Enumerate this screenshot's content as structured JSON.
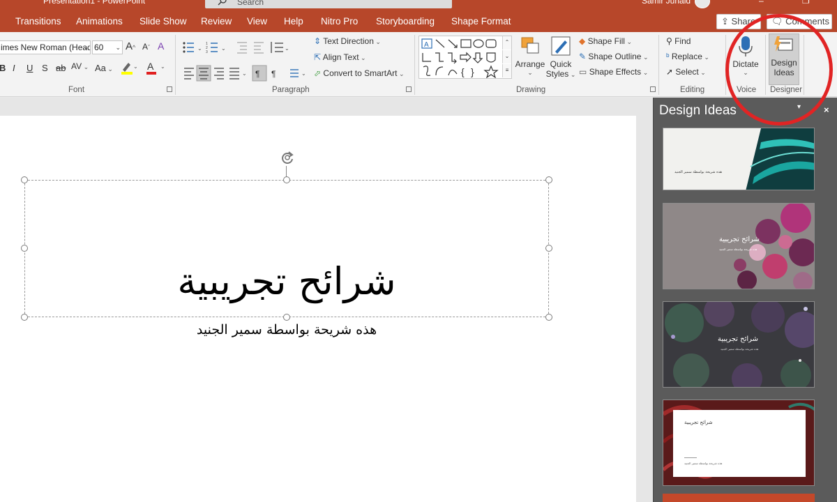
{
  "window": {
    "title": "Presentation1 - PowerPoint",
    "search_placeholder": "Search",
    "user_name": "Samir Junaid",
    "minimize": "–",
    "restore": "❐"
  },
  "tabs": [
    {
      "label": "Transitions"
    },
    {
      "label": "Animations"
    },
    {
      "label": "Slide Show"
    },
    {
      "label": "Review"
    },
    {
      "label": "View"
    },
    {
      "label": "Help"
    },
    {
      "label": "Nitro Pro"
    },
    {
      "label": "Storyboarding"
    },
    {
      "label": "Shape Format"
    }
  ],
  "share_label": "Share",
  "comments_label": "Comments",
  "font": {
    "name": "imes New Roman (Head",
    "size": "60",
    "bold": "B",
    "italic": "I",
    "underline": "U",
    "shadow": "S",
    "strike": "ab",
    "spacing": "AV",
    "case": "Aa",
    "grow": "A",
    "shrink": "A",
    "clear": "A",
    "group_label": "Font"
  },
  "paragraph": {
    "text_direction": "Text Direction",
    "align_text": "Align Text",
    "convert_smartart": "Convert to SmartArt",
    "group_label": "Paragraph"
  },
  "drawing": {
    "arrange": "Arrange",
    "quick_styles_1": "Quick",
    "quick_styles_2": "Styles",
    "shape_fill": "Shape Fill",
    "shape_outline": "Shape Outline",
    "shape_effects": "Shape Effects",
    "group_label": "Drawing"
  },
  "editing": {
    "find": "Find",
    "replace": "Replace",
    "select": "Select",
    "group_label": "Editing"
  },
  "voice": {
    "dictate": "Dictate",
    "group_label": "Voice"
  },
  "designer": {
    "design_ideas_1": "Design",
    "design_ideas_2": "Ideas",
    "group_label": "Designer"
  },
  "slide": {
    "title": "شرائح تجريبية",
    "subtitle": "هذه شريحة بواسطة سمير الجنيد"
  },
  "design_pane": {
    "title": "Design Ideas",
    "thumbs": [
      {
        "title": "",
        "subtitle": "هذه شريحة بواسطة سمير الجنيد"
      },
      {
        "title": "شرائح تجريبية",
        "subtitle": "هذه شريحة بواسطة سمير الجنيد"
      },
      {
        "title": "شرائح تجريبية",
        "subtitle": "هذه شريحة بواسطة سمير الجنيد"
      },
      {
        "title": "شرائح تجريبية",
        "subtitle": "هذه شريحة بواسطة سمير الجنيد"
      }
    ]
  },
  "colors": {
    "accent": "#b7472a",
    "annotation": "#e12424",
    "pane_bg": "#5b5b5b"
  }
}
